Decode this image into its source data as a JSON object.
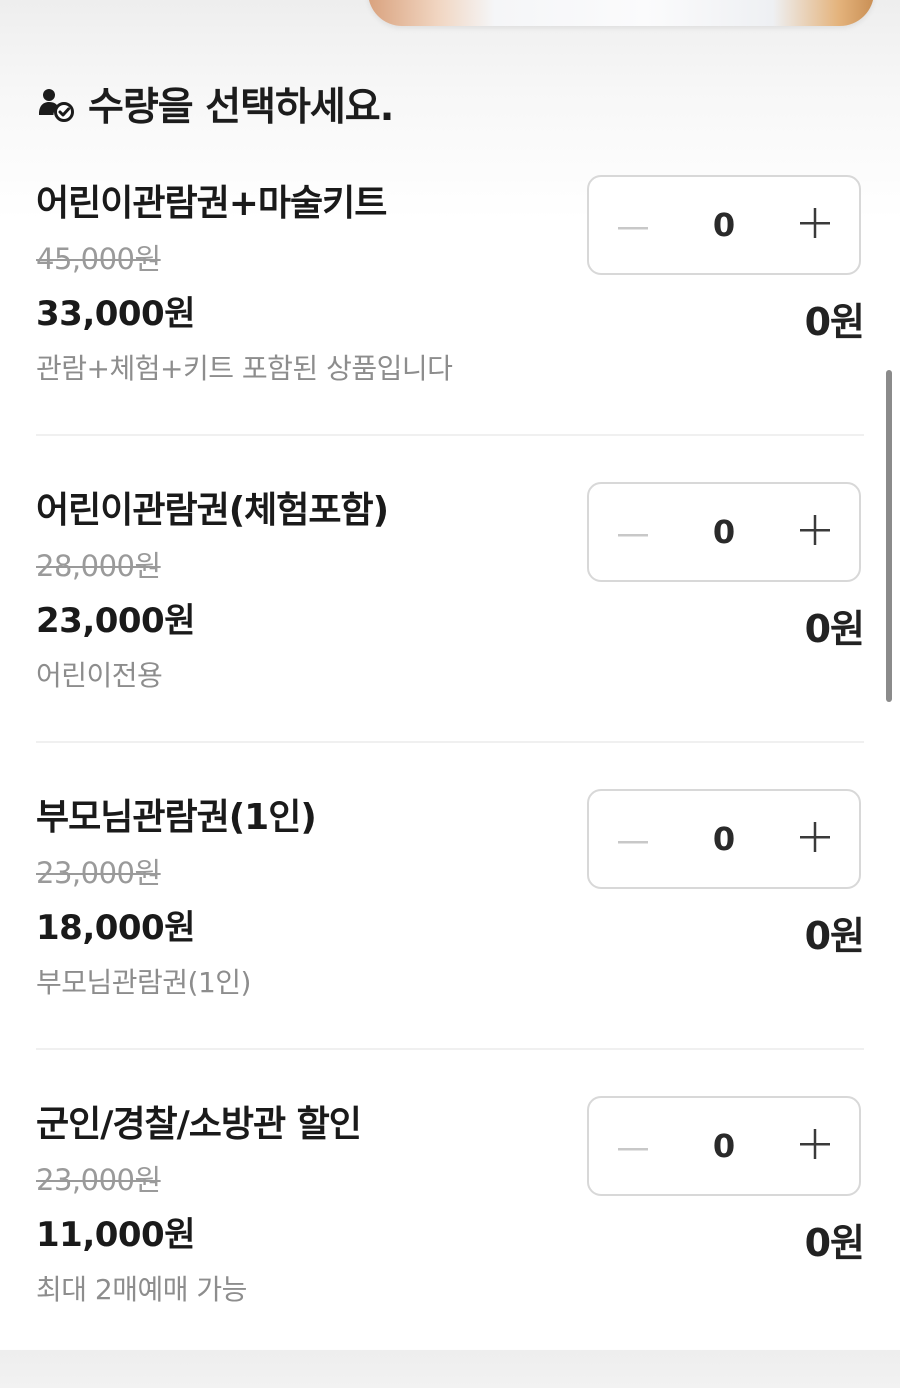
{
  "section": {
    "heading": "수량을 선택하세요."
  },
  "icons": {
    "heading": "person-check-icon",
    "decrement": "minus-icon",
    "increment": "plus-icon"
  },
  "colors": {
    "text": "#1a1a1a",
    "strike_price": "#9a9a9a",
    "note": "#8d8d8d",
    "stepper_border": "#d8d8d8",
    "disabled_minus": "#c8c8c8"
  },
  "products": [
    {
      "name": "어린이관람권+마술키트",
      "original_price": "45,000원",
      "sale_price": "33,000원",
      "note": "관람+체험+키트 포함된 상품입니다",
      "quantity": "0",
      "total": "0원"
    },
    {
      "name": "어린이관람권(체험포함)",
      "original_price": "28,000원",
      "sale_price": "23,000원",
      "note": "어린이전용",
      "quantity": "0",
      "total": "0원"
    },
    {
      "name": "부모님관람권(1인)",
      "original_price": "23,000원",
      "sale_price": "18,000원",
      "note": "부모님관람권(1인)",
      "quantity": "0",
      "total": "0원"
    },
    {
      "name": "군인/경찰/소방관 할인",
      "original_price": "23,000원",
      "sale_price": "11,000원",
      "note": "최대 2매예매 가능",
      "quantity": "0",
      "total": "0원"
    }
  ]
}
